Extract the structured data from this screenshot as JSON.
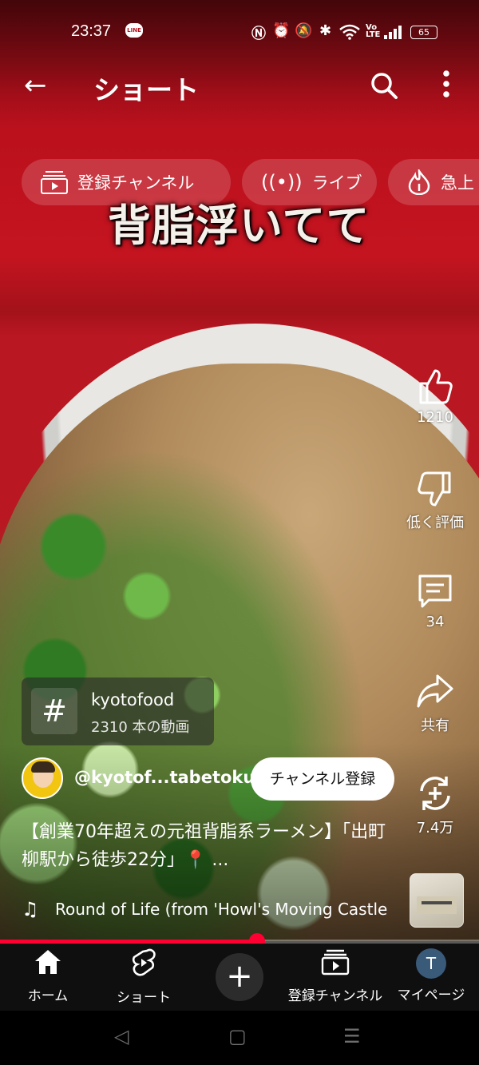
{
  "status_bar": {
    "time": "23:37",
    "line_badge": "LINE",
    "battery": "65",
    "icons": [
      "nfc-icon",
      "alarm-icon",
      "mute-icon",
      "bluetooth-icon",
      "wifi-icon",
      "volte-icon",
      "signal-icon",
      "battery-icon"
    ]
  },
  "header": {
    "title": "ショート"
  },
  "chips": [
    {
      "label": "登録チャンネル",
      "icon": "subscriptions-icon"
    },
    {
      "label": "ライブ",
      "icon": "live-icon"
    },
    {
      "label": "急上",
      "icon": "trending-icon"
    }
  ],
  "video": {
    "caption_overlay": "背脂浮いてて"
  },
  "actions": {
    "like_count": "1210",
    "dislike_label": "低く評価",
    "comment_count": "34",
    "share_label": "共有",
    "remix_count": "7.4万"
  },
  "hashtag": {
    "symbol": "#",
    "name": "kyotofood",
    "count": "2310 本の動画"
  },
  "channel": {
    "handle": "@kyotof...tabetoku",
    "subscribe_label": "チャンネル登録"
  },
  "description": "【創業70年超えの元祖背脂系ラーメン】「出町柳駅から徒歩22分」📍 ...",
  "music": {
    "title": "Round of Life (from 'Howl's Moving Castle"
  },
  "progress": {
    "fraction": 0.537
  },
  "nav": {
    "home": "ホーム",
    "shorts": "ショート",
    "create": "+",
    "subscriptions": "登録チャンネル",
    "mypage": "マイページ",
    "avatar_letter": "T"
  },
  "colors": {
    "accent": "#ff0033",
    "background": "#0f0f0f"
  }
}
